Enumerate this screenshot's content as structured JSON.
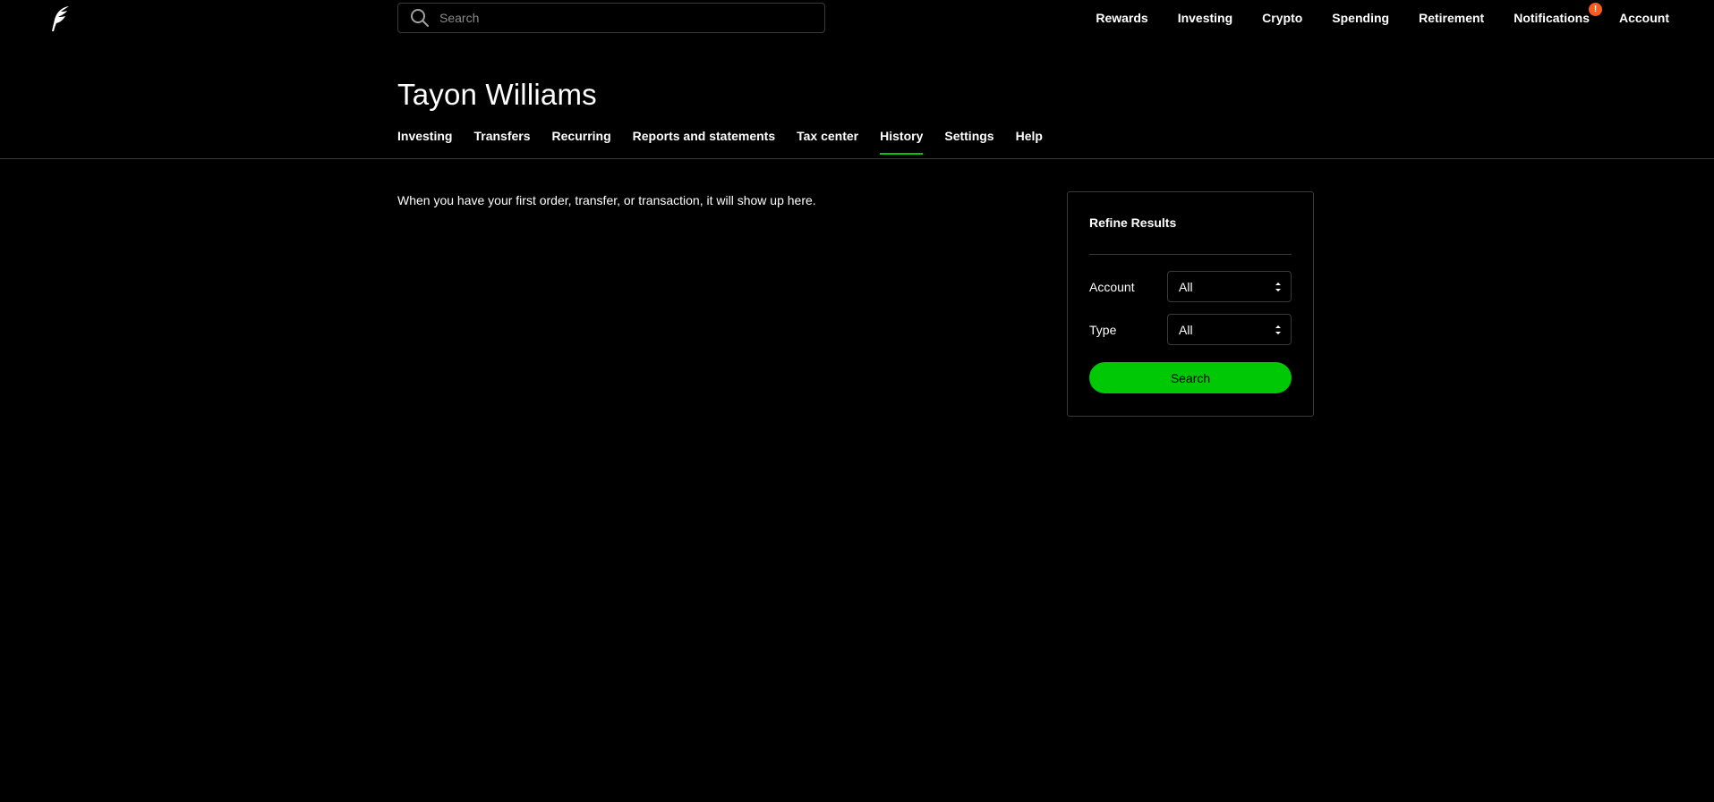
{
  "header": {
    "logo_icon": "robinhood-feather-icon",
    "search": {
      "placeholder": "Search",
      "value": ""
    },
    "nav": [
      {
        "label": "Rewards"
      },
      {
        "label": "Investing"
      },
      {
        "label": "Crypto"
      },
      {
        "label": "Spending"
      },
      {
        "label": "Retirement"
      },
      {
        "label": "Notifications",
        "badge": "!"
      },
      {
        "label": "Account"
      }
    ]
  },
  "account": {
    "name": "Tayon Williams",
    "tabs": [
      {
        "label": "Investing"
      },
      {
        "label": "Transfers"
      },
      {
        "label": "Recurring"
      },
      {
        "label": "Reports and statements"
      },
      {
        "label": "Tax center"
      },
      {
        "label": "History",
        "active": true
      },
      {
        "label": "Settings"
      },
      {
        "label": "Help"
      }
    ]
  },
  "history": {
    "empty_message": "When you have your first order, transfer, or transaction, it will show up here."
  },
  "refine": {
    "title": "Refine Results",
    "account_label": "Account",
    "account_value": "All",
    "type_label": "Type",
    "type_value": "All",
    "search_button": "Search"
  },
  "colors": {
    "background": "#000000",
    "accent_green": "#00c805",
    "badge_orange": "#ff5a1f",
    "border": "#3a3a3a"
  }
}
